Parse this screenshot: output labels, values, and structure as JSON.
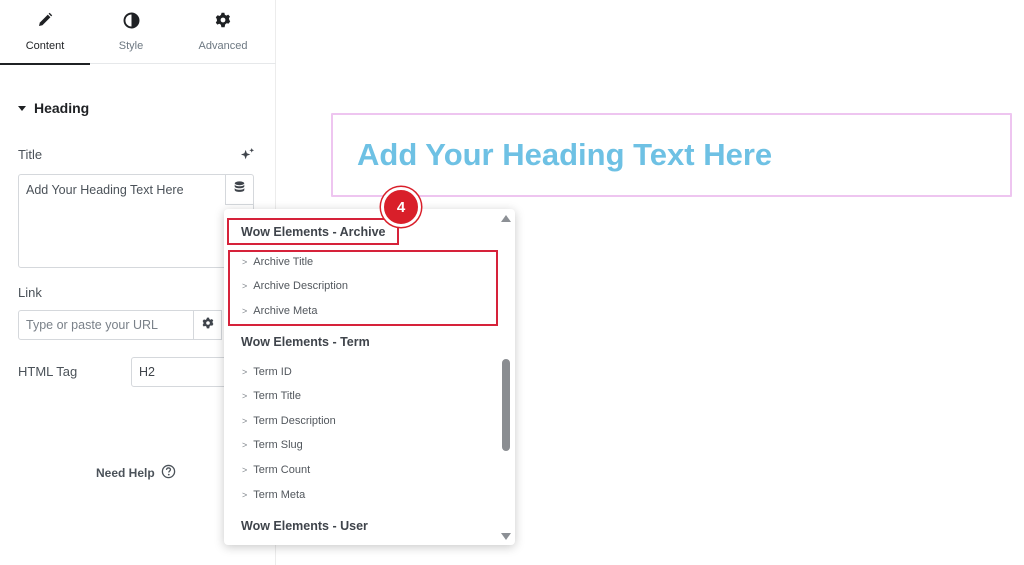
{
  "tabs": [
    {
      "label": "Content",
      "icon": "pencil-icon",
      "active": true
    },
    {
      "label": "Style",
      "icon": "half-circle-icon",
      "active": false
    },
    {
      "label": "Advanced",
      "icon": "gear-icon",
      "active": false
    }
  ],
  "section": {
    "title": "Heading"
  },
  "fields": {
    "title_label": "Title",
    "title_value": "Add Your Heading Text Here",
    "link_label": "Link",
    "link_placeholder": "Type or paste your URL",
    "html_tag_label": "HTML Tag",
    "html_tag_value": "H2"
  },
  "help": {
    "label": "Need Help"
  },
  "canvas": {
    "heading": "Add Your Heading Text Here"
  },
  "dropdown": {
    "groups": [
      {
        "title": "Wow Elements - Archive",
        "items": [
          "Archive Title",
          "Archive Description",
          "Archive Meta"
        ]
      },
      {
        "title": "Wow Elements - Term",
        "items": [
          "Term ID",
          "Term Title",
          "Term Description",
          "Term Slug",
          "Term Count",
          "Term Meta"
        ]
      },
      {
        "title": "Wow Elements - User",
        "items": []
      }
    ],
    "item_chevron": ">"
  },
  "annotation": {
    "step": "4"
  },
  "colors": {
    "accent_heading": "#6ec1e4",
    "highlight": "#d6223a",
    "selection_border": "#eec5f0"
  }
}
